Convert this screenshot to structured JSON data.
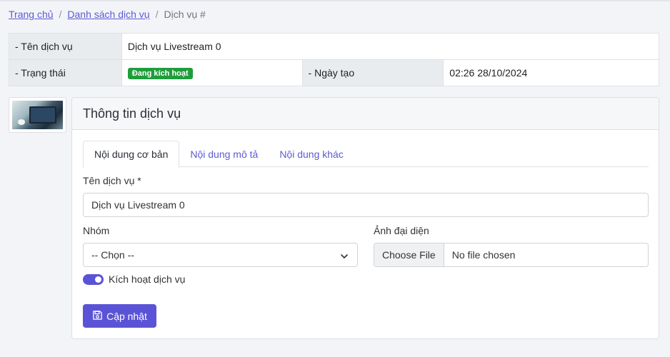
{
  "breadcrumb": {
    "home": "Trang chủ",
    "list": "Danh sách dịch vụ",
    "current": "Dịch vụ #",
    "sep": "/"
  },
  "info": {
    "name_label": "- Tên dịch vụ",
    "name_value": "Dịch vụ Livestream 0",
    "status_label": "- Trạng thái",
    "status_value": "Đang kích hoạt",
    "created_label": "- Ngày tạo",
    "created_value": "02:26 28/10/2024"
  },
  "card": {
    "title": "Thông tin dịch vụ",
    "tabs": [
      "Nội dung cơ bản",
      "Nội dung mô tả",
      "Nội dung khác"
    ],
    "name_label": "Tên dịch vụ *",
    "name_value": "Dịch vụ Livestream 0",
    "group_label": "Nhóm",
    "group_value": "-- Chọn --",
    "avatar_label": "Ảnh đại diện",
    "file_button": "Choose File",
    "file_text": "No file chosen",
    "active_label": "Kích hoạt dịch vụ",
    "save_label": "Cập nhật"
  },
  "colors": {
    "accent": "#5b53d6",
    "badge": "#1f9d3b"
  },
  "icons": [
    "chevron-down-icon",
    "save-icon",
    "service-thumbnail"
  ]
}
